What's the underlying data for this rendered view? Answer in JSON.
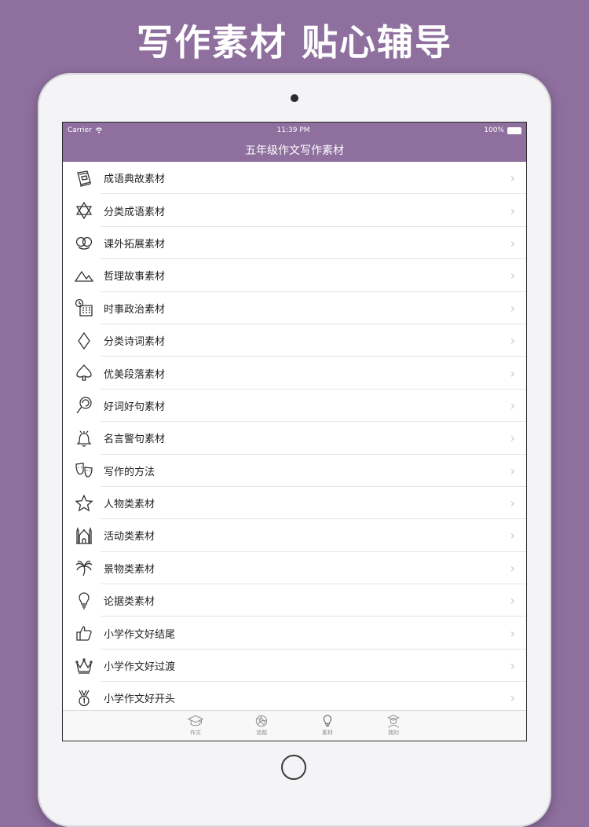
{
  "banner": "写作素材 贴心辅导",
  "statusbar": {
    "carrier": "Carrier",
    "time": "11:39 PM",
    "battery": "100%"
  },
  "navbar": {
    "title": "五年级作文写作素材"
  },
  "list": {
    "items": [
      {
        "label": "成语典故素材",
        "icon": "book-icon"
      },
      {
        "label": "分类成语素材",
        "icon": "star-of-david-icon"
      },
      {
        "label": "课外拓展素材",
        "icon": "pretzel-icon"
      },
      {
        "label": "哲理故事素材",
        "icon": "mountains-icon"
      },
      {
        "label": "时事政治素材",
        "icon": "calendar-clock-icon"
      },
      {
        "label": "分类诗词素材",
        "icon": "diamond-icon"
      },
      {
        "label": "优美段落素材",
        "icon": "spade-icon"
      },
      {
        "label": "好词好句素材",
        "icon": "lollipop-icon"
      },
      {
        "label": "名言警句素材",
        "icon": "bell-icon"
      },
      {
        "label": "写作的方法",
        "icon": "theater-masks-icon"
      },
      {
        "label": "人物类素材",
        "icon": "star-icon"
      },
      {
        "label": "活动类素材",
        "icon": "mosque-icon"
      },
      {
        "label": "景物类素材",
        "icon": "palm-tree-icon"
      },
      {
        "label": "论据类素材",
        "icon": "lightbulb-icon"
      },
      {
        "label": "小学作文好结尾",
        "icon": "thumbs-up-icon"
      },
      {
        "label": "小学作文好过渡",
        "icon": "crown-icon"
      },
      {
        "label": "小学作文好开头",
        "icon": "medal-icon"
      }
    ],
    "chevron": "›"
  },
  "tabbar": {
    "tabs": [
      {
        "label": "作文",
        "icon": "graduation-cap-icon"
      },
      {
        "label": "话题",
        "icon": "aperture-icon"
      },
      {
        "label": "素材",
        "icon": "lightbulb-icon"
      },
      {
        "label": "我的",
        "icon": "student-avatar-icon"
      }
    ]
  }
}
